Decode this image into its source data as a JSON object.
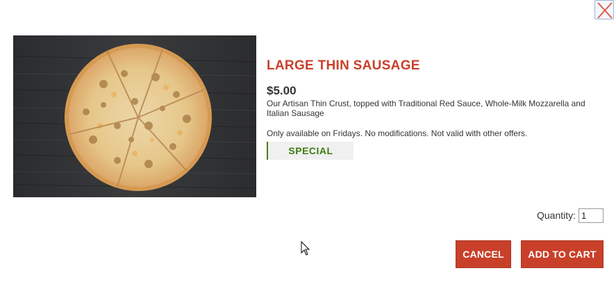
{
  "dialog": {
    "close_icon": "close-x-icon"
  },
  "product": {
    "image_icon": "pizza-photo",
    "title": "LARGE THIN SAUSAGE",
    "price": "$5.00",
    "description": "Our Artisan Thin Crust, topped with Traditional Red Sauce, Whole-Milk Mozzarella and Italian Sausage",
    "availability": "Only available on Fridays. No modifications. Not valid with other offers.",
    "badge": "SPECIAL"
  },
  "order": {
    "quantity_label": "Quantity:",
    "quantity_value": "1",
    "cancel_label": "CANCEL",
    "add_to_cart_label": "ADD TO CART"
  },
  "colors": {
    "accent": "#c9402a",
    "badge_text": "#3f7a12",
    "badge_bg": "#f0f0f0"
  }
}
